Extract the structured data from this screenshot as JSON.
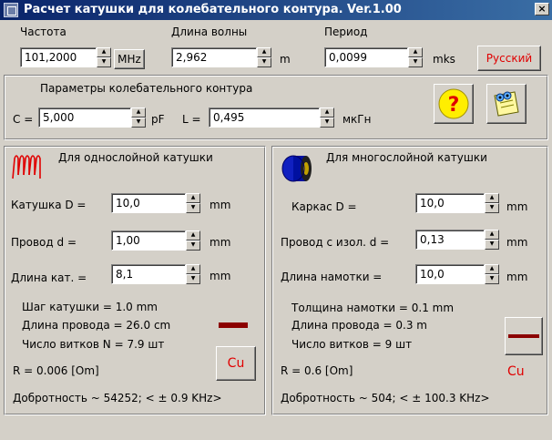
{
  "window": {
    "title": "Расчет катушки для колебательного контура. Ver.1.00",
    "close_glyph": "×"
  },
  "top": {
    "freq_label": "Частота",
    "freq_value": "101,2000",
    "freq_unit": "MHz",
    "wave_label": "Длина волны",
    "wave_value": "2,962",
    "wave_unit": "m",
    "period_label": "Период",
    "period_value": "0,0099",
    "period_unit": "mks",
    "lang_button": "Русский"
  },
  "circuit": {
    "title": "Параметры колебательного контура",
    "c_label": "C =",
    "c_value": "5,000",
    "c_unit": "pF",
    "l_label": "L =",
    "l_value": "0,495",
    "l_unit": "мкГн",
    "help_glyph": "?"
  },
  "single": {
    "title": "Для однослойной катушки",
    "d_label": "Катушка D =",
    "d_value": "10,0",
    "d_unit": "mm",
    "wire_label": "Провод  d =",
    "wire_value": "1,00",
    "wire_unit": "mm",
    "len_label": "Длина кат. =",
    "len_value": "8,1",
    "len_unit": "mm",
    "pitch_text": "Шаг катушки =   1.0 mm",
    "wire_len_text": "Длина провода =  26.0 cm",
    "turns_text": "Число витков N =   7.9 шт",
    "r_text": "R =   0.006 [Om]",
    "q_text": "Добротность ~  54252; < ±  0.9 KHz>",
    "cu_label": "Cu"
  },
  "multi": {
    "title": "Для многослойной катушки",
    "d_label": "Каркас   D =",
    "d_value": "10,0",
    "d_unit": "mm",
    "wire_label": "Провод с изол. d =",
    "wire_value": "0,13",
    "wire_unit": "mm",
    "len_label": "Длина намотки   =",
    "len_value": "10,0",
    "len_unit": "mm",
    "thick_text": "Толщина намотки =   0.1 mm",
    "wire_len_text": "Длина провода  =   0.3 m",
    "turns_text": "Число витков  =       9 шт",
    "r_text": "R =   0.6 [Om]",
    "q_text": "Добротность ~     504; < ± 100.3 KHz>",
    "cu_label": "Cu"
  },
  "colors": {
    "accent_red": "#e00000",
    "wire_dark": "#8b0000",
    "title_blue": "#0a246a",
    "coil_blue": "#0000c0"
  }
}
